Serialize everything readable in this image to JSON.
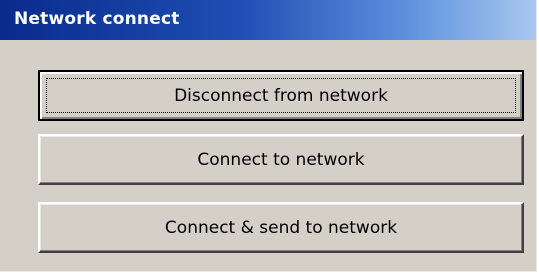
{
  "window": {
    "title": "Network connect"
  },
  "buttons": {
    "disconnect_label": "Disconnect from network",
    "connect_label": "Connect to network",
    "connect_send_label": "Connect & send to network"
  },
  "colors": {
    "titlebar_start": "#0a2a8c",
    "titlebar_end": "#a8c8f0",
    "face": "#d4d0c8",
    "title_text": "#ffffff"
  }
}
